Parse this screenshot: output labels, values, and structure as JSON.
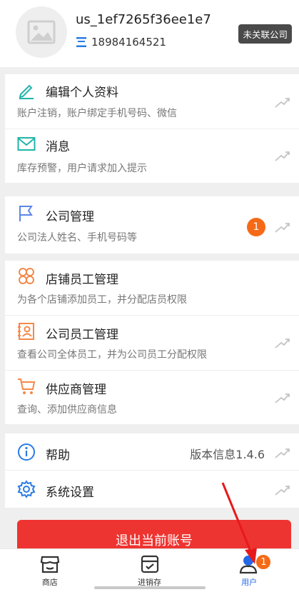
{
  "profile": {
    "username": "us_1ef7265f36ee1e7",
    "phone": "18984164521",
    "company_status": "未关联公司"
  },
  "menu": {
    "edit_profile": {
      "title": "编辑个人资料",
      "sub": "账户注销，账户绑定手机号码、微信"
    },
    "messages": {
      "title": "消息",
      "sub": "库存预警，用户请求加入提示"
    },
    "company": {
      "title": "公司管理",
      "sub": "公司法人姓名、手机号码等",
      "badge": "1"
    },
    "store_staff": {
      "title": "店铺员工管理",
      "sub": "为各个店铺添加员工，并分配店员权限"
    },
    "company_staff": {
      "title": "公司员工管理",
      "sub": "查看公司全体员工，并为公司员工分配权限"
    },
    "supplier": {
      "title": "供应商管理",
      "sub": "查询、添加供应商信息"
    },
    "help": {
      "title": "帮助",
      "version": "版本信息1.4.6"
    },
    "settings": {
      "title": "系统设置"
    }
  },
  "logout_label": "退出当前账号",
  "tabs": [
    {
      "label": "商店"
    },
    {
      "label": "进销存"
    },
    {
      "label": "用户",
      "badge": "1"
    }
  ],
  "colors": {
    "accent": "#2468e8",
    "danger": "#ee3430",
    "badge": "#f56a16",
    "teal": "#1fb5a8",
    "orange": "#f5884a",
    "blue": "#5b86e6"
  }
}
